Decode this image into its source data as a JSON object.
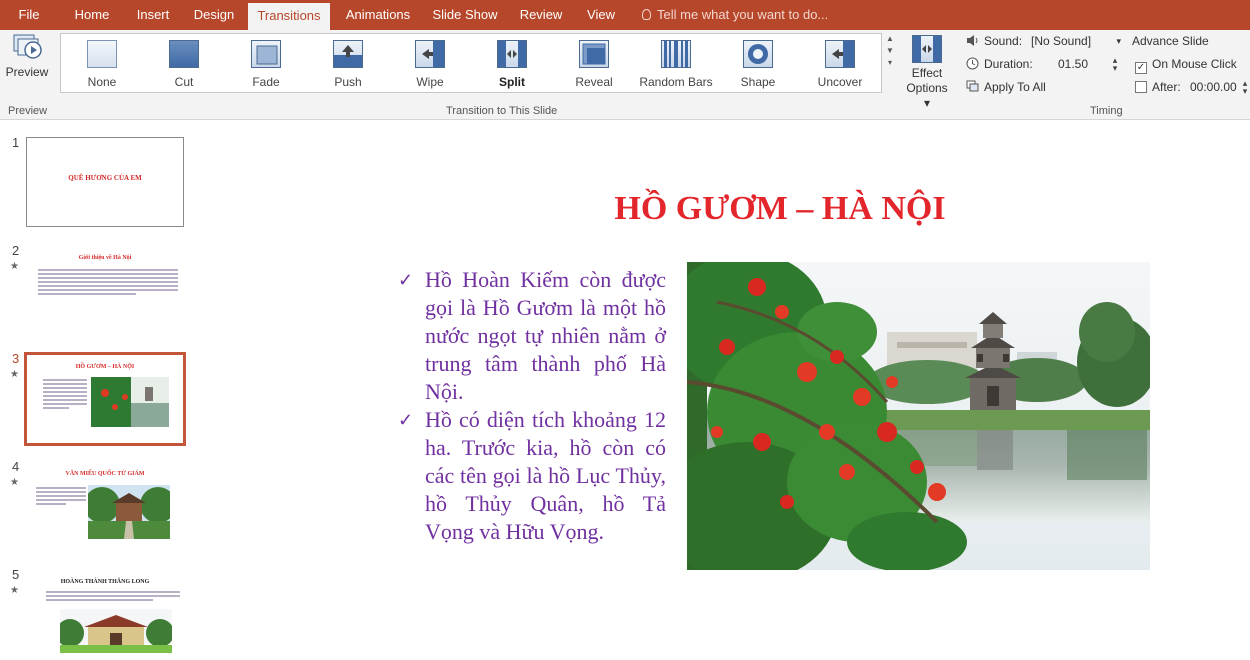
{
  "menu": {
    "file": "File",
    "home": "Home",
    "insert": "Insert",
    "design": "Design",
    "transitions": "Transitions",
    "animations": "Animations",
    "slideshow": "Slide Show",
    "review": "Review",
    "view": "View",
    "tellme": "Tell me what you want to do..."
  },
  "ribbon": {
    "preview_label": "Preview",
    "preview_group": "Preview",
    "transition_group": "Transition to This Slide",
    "transitions": [
      {
        "label": "None"
      },
      {
        "label": "Cut"
      },
      {
        "label": "Fade"
      },
      {
        "label": "Push"
      },
      {
        "label": "Wipe"
      },
      {
        "label": "Split"
      },
      {
        "label": "Reveal"
      },
      {
        "label": "Random Bars"
      },
      {
        "label": "Shape"
      },
      {
        "label": "Uncover"
      }
    ],
    "selected_transition": "Split",
    "effect_options_line1": "Effect",
    "effect_options_line2": "Options",
    "timing": {
      "sound_label": "Sound:",
      "sound_value": "[No Sound]",
      "duration_label": "Duration:",
      "duration_value": "01.50",
      "apply_all": "Apply To All",
      "advance_label": "Advance Slide",
      "on_mouse_click": "On Mouse Click",
      "on_mouse_click_checked": true,
      "after_label": "After:",
      "after_value": "00:00.00",
      "after_checked": false,
      "group_label": "Timing"
    }
  },
  "thumbnails": [
    {
      "number": "1",
      "title": "QUÊ HƯƠNG CỦA EM"
    },
    {
      "number": "2",
      "title": "Giới thiệu về Hà Nội"
    },
    {
      "number": "3",
      "title": "HỒ GƯƠM – HÀ NỘI"
    },
    {
      "number": "4",
      "title": "VĂN MIẾU QUỐC TỬ GIÁM"
    },
    {
      "number": "5",
      "title": "HOÀNG THÀNH THĂNG LONG"
    }
  ],
  "slide": {
    "title": "HỒ GƯƠM – HÀ NỘI",
    "bullets": [
      "Hồ Hoàn Kiếm còn được gọi là Hồ Gươm là một hồ nước ngọt tự nhiên nằm ở trung tâm thành phố Hà Nội.",
      "Hồ có diện tích khoảng 12 ha. Trước kia, hồ còn có các tên gọi là hồ Lục Thủy, hồ Thủy Quân, hồ Tả Vọng và Hữu Vọng."
    ]
  },
  "colors": {
    "accent": "#b7472a",
    "slide_title": "#e2262b",
    "body_text": "#7030a0"
  }
}
